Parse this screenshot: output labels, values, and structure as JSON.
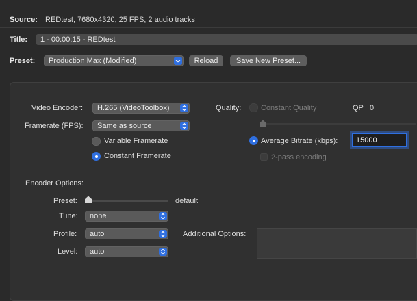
{
  "source": {
    "label": "Source:",
    "value": "REDtest, 7680x4320, 25 FPS, 2 audio tracks"
  },
  "title": {
    "label": "Title:",
    "value": "1 - 00:00:15 - REDtest"
  },
  "preset": {
    "label": "Preset:",
    "selected": "Production Max (Modified)",
    "reload_label": "Reload",
    "save_label": "Save New Preset..."
  },
  "video": {
    "encoder_label": "Video Encoder:",
    "encoder_value": "H.265 (VideoToolbox)",
    "framerate_label": "Framerate (FPS):",
    "framerate_value": "Same as source",
    "variable_label": "Variable Framerate",
    "constant_label": "Constant Framerate",
    "framerate_mode": "constant"
  },
  "quality": {
    "label": "Quality:",
    "constant_quality_label": "Constant Quality",
    "qp_label": "QP",
    "qp_value": "0",
    "avg_bitrate_label": "Average Bitrate (kbps):",
    "avg_bitrate_value": "15000",
    "two_pass_label": "2-pass encoding",
    "mode": "average-bitrate",
    "two_pass_checked": false
  },
  "encoder_options": {
    "header": "Encoder Options:",
    "preset_label": "Preset:",
    "preset_value": "default",
    "preset_level": 0,
    "tune_label": "Tune:",
    "tune_value": "none",
    "profile_label": "Profile:",
    "profile_value": "auto",
    "level_label": "Level:",
    "level_value": "auto",
    "additional_label": "Additional Options:",
    "additional_value": ""
  },
  "colors": {
    "accent": "#2f6fe0",
    "background": "#2a2a2a",
    "panel": "#303030"
  },
  "icons": [
    "popup-stepper-icon",
    "slider-thumb-icon"
  ]
}
